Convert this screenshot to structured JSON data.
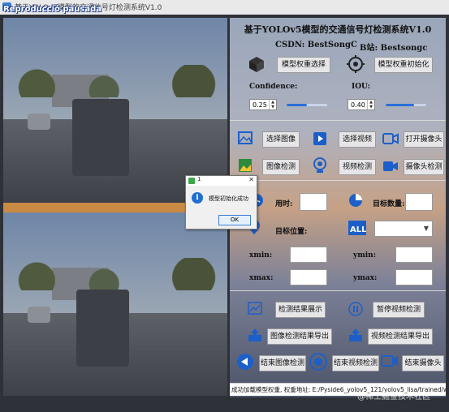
{
  "window": {
    "title": "基于YOLOv5模型的交通信号灯检测系统V1.0",
    "overlay": "Reproducció pausada"
  },
  "panel": {
    "title": "基于YOLOv5模型的交通信号灯检测系统V1.0",
    "csdn": "CSDN: BestSongC",
    "bilibili": "B站: Bestsongc",
    "model_select": "模型权重选择",
    "model_init": "模型权重初始化",
    "confidence_label": "Confidence:",
    "confidence_value": "0.25",
    "iou_label": "IOU:",
    "iou_value": "0.40",
    "confidence_level": 0.5,
    "iou_level": 0.7,
    "select_image": "选择图像",
    "select_video": "选择视频",
    "open_camera": "打开摄像头",
    "image_detect": "图像检测",
    "video_detect": "视频检测",
    "camera_detect": "摄像头检测",
    "time_label": "用时:",
    "target_count_label": "目标数量:",
    "target_pos_label": "目标位置:",
    "xmin": "xmin:",
    "ymin": "ymin:",
    "xmax": "xmax:",
    "ymax": "ymax:",
    "show_result": "检测结果展示",
    "pause_video": "暂停视频检测",
    "export_image": "图像检测结果导出",
    "export_video": "视频检测结果导出",
    "end_image": "结束图像检测",
    "end_video": "结束视频检测",
    "end_camera": "结束摄像头",
    "status": "成功加载模型权重, 权重地址: E:/Pyside6_yolov5_121/yolov5_lisa/trained/weights/best.pt"
  },
  "dialog": {
    "number": "1",
    "close": "✕",
    "icon_letter": "i",
    "message": "模型初始化成功",
    "ok": "OK"
  },
  "watermark": "@稀土掘金技术社区"
}
